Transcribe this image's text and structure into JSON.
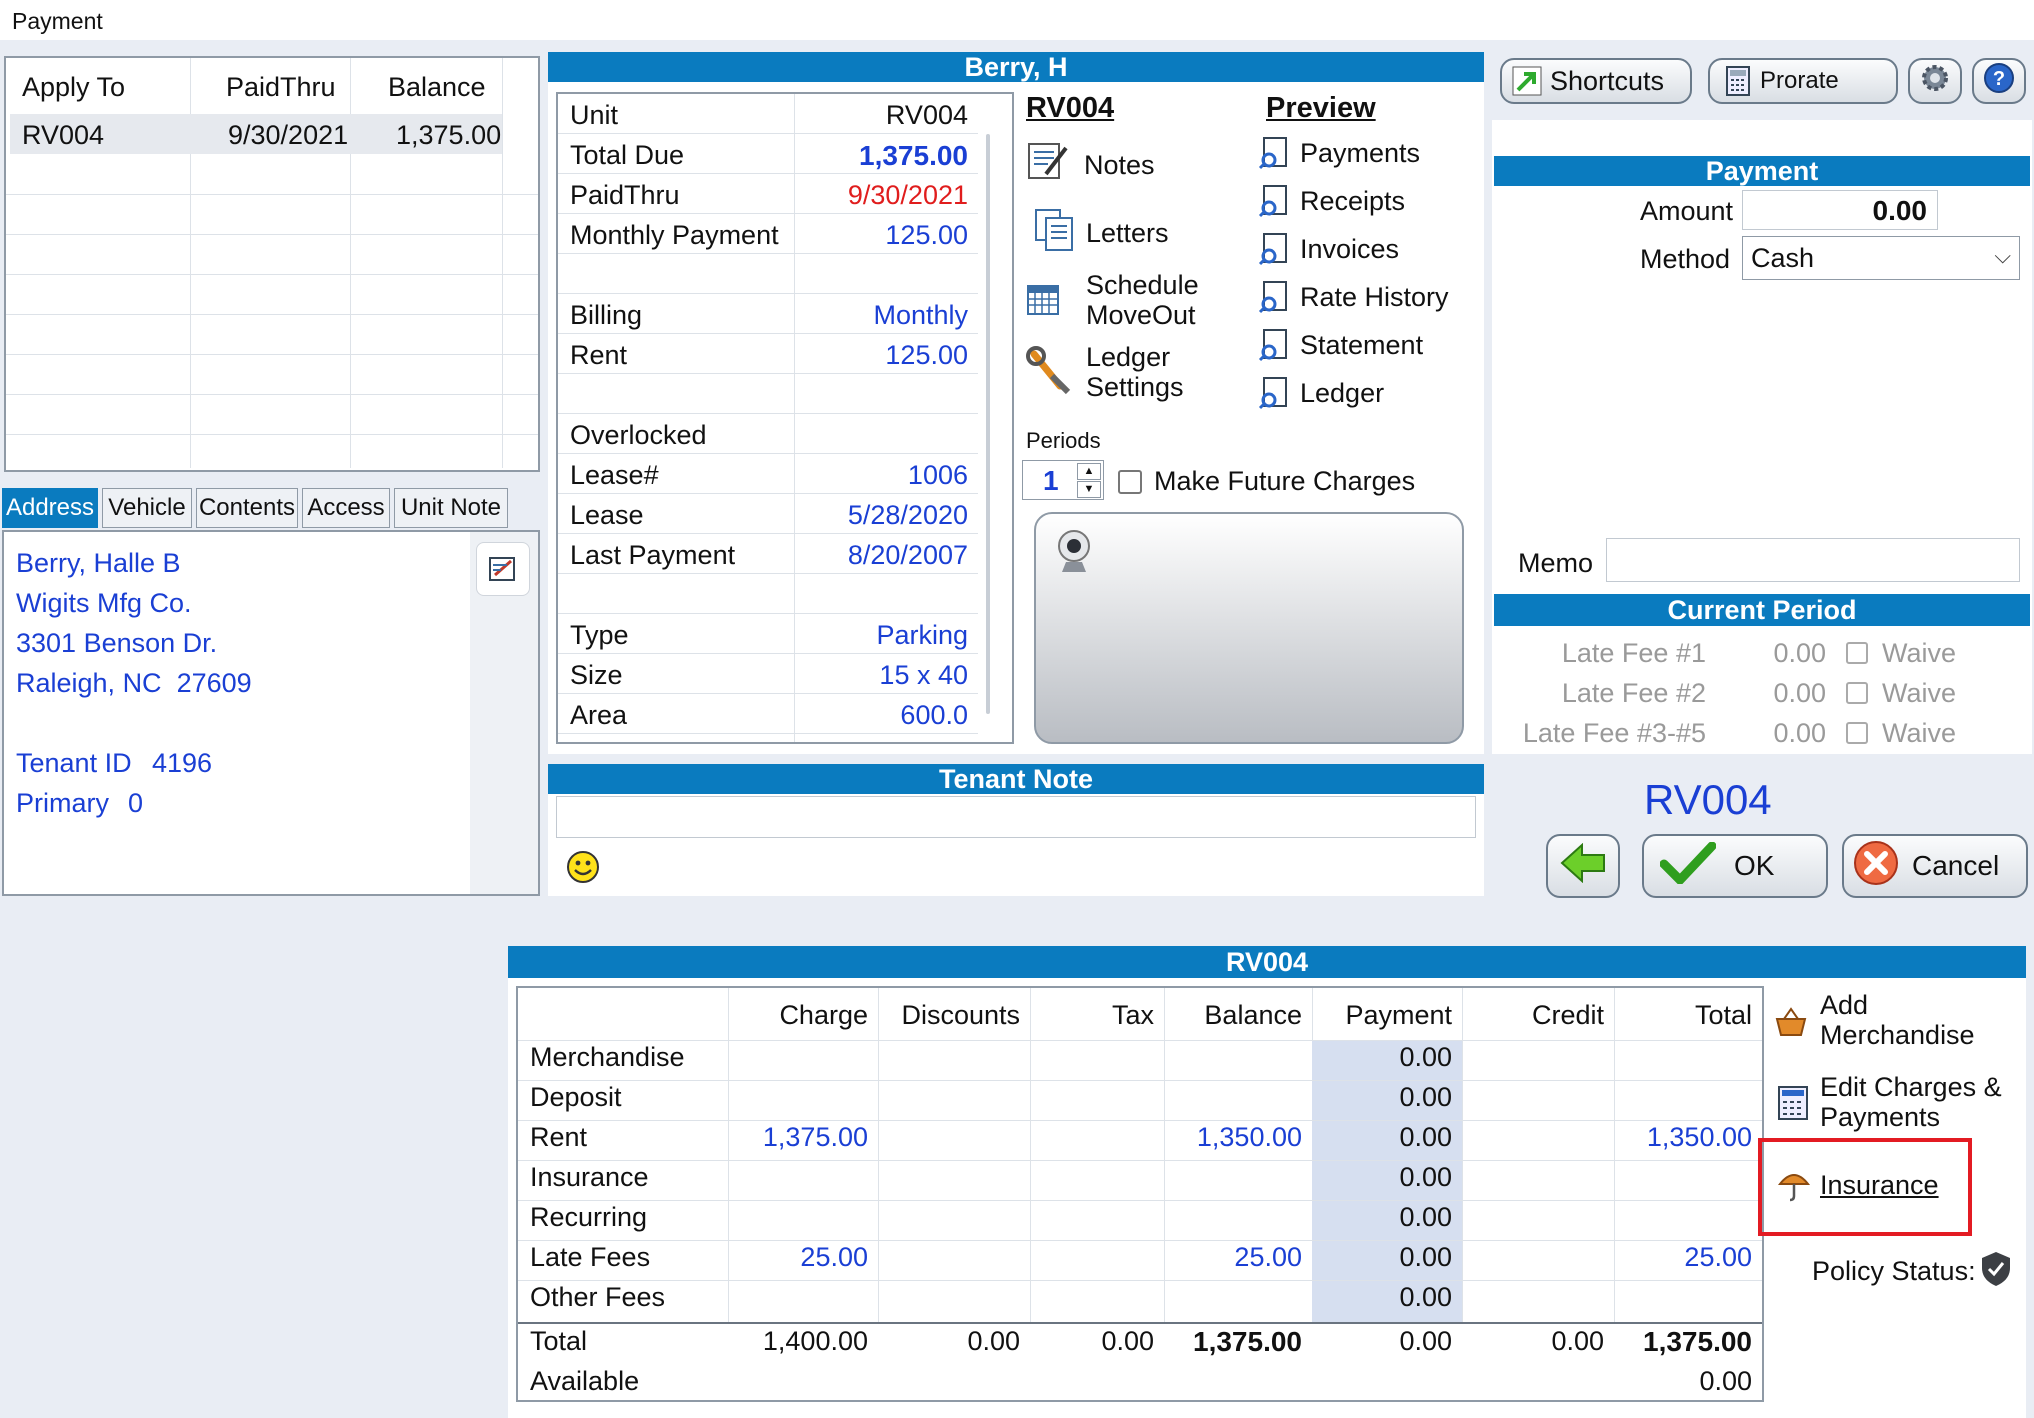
{
  "window": {
    "title": "Payment"
  },
  "apply_grid": {
    "headers": [
      "Apply To",
      "PaidThru",
      "Balance"
    ],
    "rows": [
      [
        "RV004",
        "9/30/2021",
        "1,375.00"
      ]
    ]
  },
  "tabs": [
    "Address",
    "Vehicle",
    "Contents",
    "Access",
    "Unit Note"
  ],
  "address": {
    "lines": [
      "Berry, Halle B",
      "Wigits Mfg Co.",
      "3301 Benson Dr.",
      "Raleigh, NC  27609"
    ],
    "tenant_id_label": "Tenant ID",
    "tenant_id": "4196",
    "primary_label": "Primary",
    "primary": "0"
  },
  "tenant_header": "Berry, H",
  "unit_info": {
    "rows": [
      {
        "label": "Unit",
        "value": "RV004",
        "color": "#111111"
      },
      {
        "label": "Total Due",
        "value": "1,375.00",
        "color": "#1a3fd4",
        "bold": true
      },
      {
        "label": "PaidThru",
        "value": "9/30/2021",
        "color": "#e01d1d"
      },
      {
        "label": "Monthly Payment",
        "value": "125.00",
        "color": "#1a3fd4"
      },
      {
        "label": "",
        "value": ""
      },
      {
        "label": "Billing",
        "value": "Monthly",
        "color": "#1a3fd4"
      },
      {
        "label": "Rent",
        "value": "125.00",
        "color": "#1a3fd4"
      },
      {
        "label": "",
        "value": ""
      },
      {
        "label": "Overlocked",
        "value": ""
      },
      {
        "label": "Lease#",
        "value": "1006",
        "color": "#1a3fd4"
      },
      {
        "label": "Lease",
        "value": "5/28/2020",
        "color": "#1a3fd4"
      },
      {
        "label": "Last Payment",
        "value": "8/20/2007",
        "color": "#1a3fd4"
      },
      {
        "label": "",
        "value": ""
      },
      {
        "label": "Type",
        "value": "Parking",
        "color": "#1a3fd4"
      },
      {
        "label": "Size",
        "value": "15 x 40",
        "color": "#1a3fd4"
      },
      {
        "label": "Area",
        "value": "600.0",
        "color": "#1a3fd4"
      }
    ]
  },
  "actions": {
    "unit": "RV004",
    "notes": "Notes",
    "letters": "Letters",
    "schedule": "Schedule",
    "moveout": "MoveOut",
    "ledger": "Ledger",
    "settings": "Settings"
  },
  "preview": {
    "title": "Preview",
    "items": [
      "Payments",
      "Receipts",
      "Invoices",
      "Rate History",
      "Statement",
      "Ledger"
    ]
  },
  "periods": {
    "label": "Periods",
    "value": "1",
    "future_label": "Make Future Charges"
  },
  "tenant_note": {
    "header": "Tenant Note",
    "text": ""
  },
  "toolbar": {
    "shortcuts": "Shortcuts",
    "prorate": "Prorate"
  },
  "payment": {
    "header": "Payment",
    "amount_label": "Amount",
    "amount": "0.00",
    "method_label": "Method",
    "method": "Cash",
    "memo_label": "Memo",
    "memo": ""
  },
  "current_period": {
    "header": "Current Period",
    "fees": [
      {
        "label": "Late Fee #1",
        "value": "0.00",
        "waive": "Waive"
      },
      {
        "label": "Late Fee #2",
        "value": "0.00",
        "waive": "Waive"
      },
      {
        "label": "Late Fee #3-#5",
        "value": "0.00",
        "waive": "Waive"
      }
    ]
  },
  "unit_big": "RV004",
  "buttons": {
    "ok": "OK",
    "cancel": "Cancel"
  },
  "charges": {
    "header": "RV004",
    "columns": [
      "",
      "Charge",
      "Discounts",
      "Tax",
      "Balance",
      "Payment",
      "Credit",
      "Total"
    ],
    "rows": [
      [
        "Merchandise",
        "",
        "",
        "",
        "",
        "0.00",
        "",
        ""
      ],
      [
        "Deposit",
        "",
        "",
        "",
        "",
        "0.00",
        "",
        ""
      ],
      [
        "Rent",
        "1,375.00",
        "",
        "",
        "1,350.00",
        "0.00",
        "",
        "1,350.00"
      ],
      [
        "Insurance",
        "",
        "",
        "",
        "",
        "0.00",
        "",
        ""
      ],
      [
        "Recurring",
        "",
        "",
        "",
        "",
        "0.00",
        "",
        ""
      ],
      [
        "Late Fees",
        "25.00",
        "",
        "",
        "25.00",
        "0.00",
        "",
        "25.00"
      ],
      [
        "Other Fees",
        "",
        "",
        "",
        "",
        "0.00",
        "",
        ""
      ]
    ],
    "total": [
      "Total",
      "1,400.00",
      "0.00",
      "0.00",
      "1,375.00",
      "0.00",
      "0.00",
      "1,375.00"
    ],
    "available": [
      "Available",
      "0.00"
    ]
  },
  "side_links": {
    "add_merch_1": "Add",
    "add_merch_2": "Merchandise",
    "edit_1": "Edit Charges &",
    "edit_2": "Payments",
    "insurance": "Insurance",
    "policy_status": "Policy Status:"
  },
  "colors": {
    "accent": "#0a7bbf",
    "link": "#1a3fd4",
    "highlight": "#e01d1d"
  }
}
